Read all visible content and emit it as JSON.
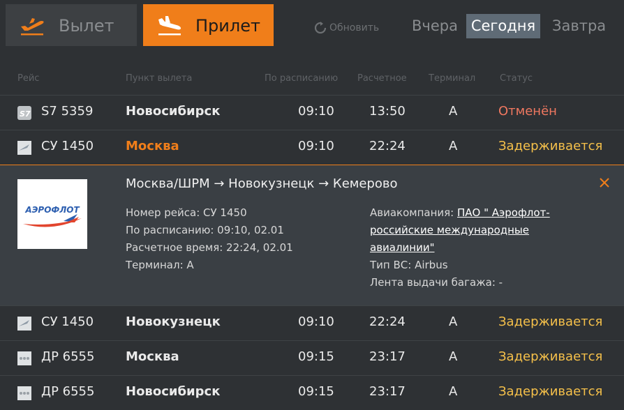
{
  "top": {
    "departures_label": "Вылет",
    "arrivals_label": "Прилет",
    "refresh_label": "Обновить",
    "days": {
      "yesterday": "Вчера",
      "today": "Сегодня",
      "tomorrow": "Завтра"
    }
  },
  "columns": {
    "flight": "Рейс",
    "origin": "Пункт вылета",
    "scheduled": "По расписанию",
    "estimated": "Расчетное",
    "terminal": "Терминал",
    "status": "Статус"
  },
  "rows": [
    {
      "logo": "s7-logo-icon",
      "flight": "S7 5359",
      "city": "Новосибирск",
      "scheduled": "09:10",
      "estimated": "13:50",
      "terminal": "A",
      "status": "Отменён"
    },
    {
      "logo": "aeroflot-logo-icon",
      "flight": "СУ 1450",
      "city": "Москва",
      "scheduled": "09:10",
      "estimated": "22:24",
      "terminal": "A",
      "status": "Задерживается"
    },
    {
      "logo": "aeroflot-logo-icon",
      "flight": "СУ 1450",
      "city": "Новокузнецк",
      "scheduled": "09:10",
      "estimated": "22:24",
      "terminal": "A",
      "status": "Задерживается"
    },
    {
      "logo": "dots-logo-icon",
      "flight": "ДР 6555",
      "city": "Москва",
      "scheduled": "09:15",
      "estimated": "23:17",
      "terminal": "A",
      "status": "Задерживается"
    },
    {
      "logo": "dots-logo-icon",
      "flight": "ДР 6555",
      "city": "Новосибирск",
      "scheduled": "09:15",
      "estimated": "23:17",
      "terminal": "A",
      "status": "Задерживается"
    }
  ],
  "detail": {
    "route": "Москва/ШРМ → Новокузнецк → Кемерово",
    "flight_number": "Номер рейса: СУ 1450",
    "scheduled": "По расписанию: 09:10, 02.01",
    "estimated": "Расчетное время: 22:24, 02.01",
    "terminal": "Терминал: A",
    "airline_label": "Авиакомпания: ",
    "airline_line1": "ПАО \" Аэрофлот-",
    "airline_line2": "российские международные",
    "airline_line3": "авиалинии\"",
    "aircraft": "Тип ВС: Airbus",
    "baggage": "Лента выдачи багажа: -",
    "logo_text": "АЭРОФЛОТ"
  },
  "colors": {
    "accent": "#f07e1a",
    "cancelled": "#f07860",
    "delayed": "#f5c04a"
  }
}
